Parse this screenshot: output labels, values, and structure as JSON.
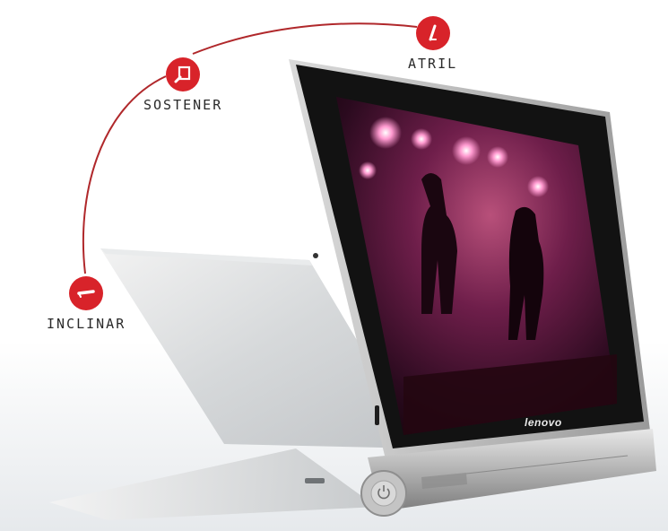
{
  "modes": {
    "atril": {
      "label": "ATRIL",
      "icon": "stand-mode-icon"
    },
    "sostener": {
      "label": "SOSTENER",
      "icon": "hold-mode-icon"
    },
    "inclinar": {
      "label": "INCLINAR",
      "icon": "tilt-mode-icon"
    }
  },
  "device": {
    "brand": "lenovo"
  },
  "colors": {
    "badge_red": "#d8232a",
    "arc_red": "#b0282b",
    "device_silver": "#c9c9c9",
    "bezel": "#121212"
  }
}
